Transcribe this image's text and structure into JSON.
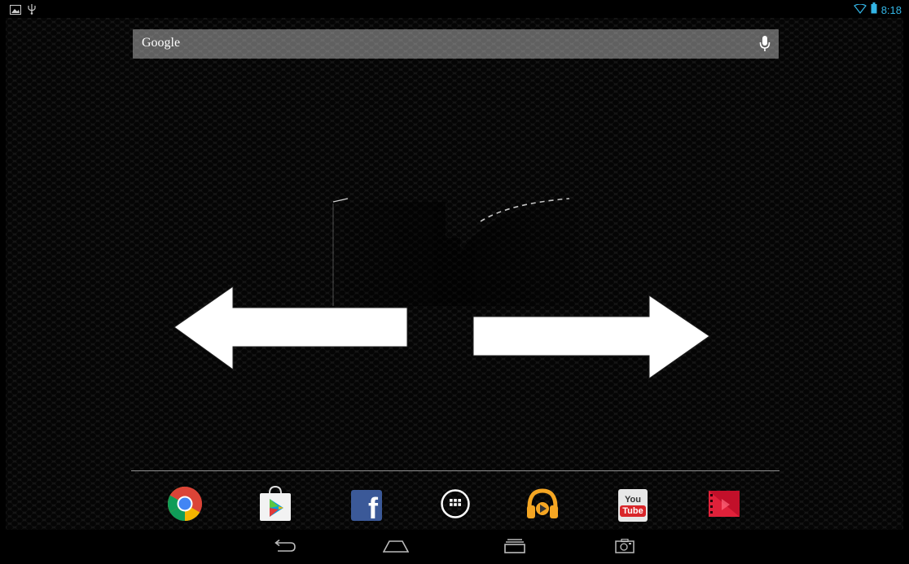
{
  "status_bar": {
    "time": "8:18",
    "left_icons": [
      "gallery-icon",
      "usb-icon"
    ],
    "right_icons": [
      "wifi-icon",
      "battery-icon"
    ]
  },
  "search": {
    "label": "Google",
    "icon": "mic-icon"
  },
  "gesture_arrows": [
    "swipe-left-arrow",
    "swipe-right-arrow"
  ],
  "dock": {
    "apps": [
      {
        "name": "Chrome",
        "icon": "chrome-icon"
      },
      {
        "name": "Play Store",
        "icon": "play-store-icon"
      },
      {
        "name": "Facebook",
        "icon": "facebook-icon",
        "glyph": "f"
      },
      {
        "name": "All apps",
        "icon": "app-drawer-icon"
      },
      {
        "name": "Play Music",
        "icon": "play-music-icon"
      },
      {
        "name": "YouTube",
        "icon": "youtube-icon",
        "text_top": "You",
        "text_bottom": "Tube"
      },
      {
        "name": "Play Movies",
        "icon": "play-movies-icon"
      }
    ]
  },
  "nav_bar": {
    "buttons": [
      "back-icon",
      "home-icon",
      "recents-icon",
      "screenshot-icon"
    ]
  },
  "colors": {
    "accent": "#33b5e5",
    "facebook": "#3b5998",
    "youtube_red": "#d9262a"
  }
}
